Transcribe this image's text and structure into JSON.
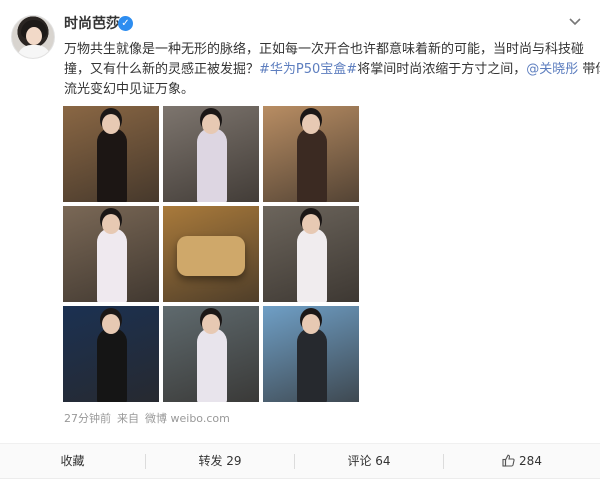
{
  "post": {
    "username": "时尚芭莎",
    "verified_symbol": "✓",
    "text_line1_a": "万物共生就像是一种无形的脉络，正如每一次开合也许都意味着新的可能，当时尚与科技碰",
    "text_line2_a": "撞，又有什么新的灵感正被发掘？",
    "hashtag": "#华为P50宝盒#",
    "text_line2_b": "将掌间时尚浓缩于方寸之间，",
    "mention": "@关晓彤",
    "text_line2_c": " 带你在",
    "text_line3": "流光变幻中见证万象。",
    "images": [
      {
        "name": "photo-1",
        "bg": "#8a6744",
        "fg": "#1c1614"
      },
      {
        "name": "photo-2",
        "bg": "#7d756e",
        "fg": "#ddd6e2"
      },
      {
        "name": "photo-3",
        "bg": "#b88d63",
        "fg": "#3b2a22"
      },
      {
        "name": "photo-4",
        "bg": "#7a6856",
        "fg": "#efe9ef"
      },
      {
        "name": "photo-5",
        "bg": "#a97a3b",
        "fg": "#cfa86a"
      },
      {
        "name": "photo-6",
        "bg": "#6c655c",
        "fg": "#f0ecee"
      },
      {
        "name": "photo-7",
        "bg": "#1b3152",
        "fg": "#151515"
      },
      {
        "name": "photo-8",
        "bg": "#5f6a6e",
        "fg": "#e8e4ec"
      },
      {
        "name": "photo-9",
        "bg": "#6f9fc6",
        "fg": "#26292e"
      }
    ],
    "time": "27分钟前",
    "source_prefix": "来自",
    "source": "微博 weibo.com"
  },
  "actions": {
    "collect": "收藏",
    "repost": "转发 29",
    "comment": "评论 64",
    "like_count": "284"
  },
  "colors": {
    "link": "#5d7ebf",
    "verified": "#2d8df0"
  }
}
